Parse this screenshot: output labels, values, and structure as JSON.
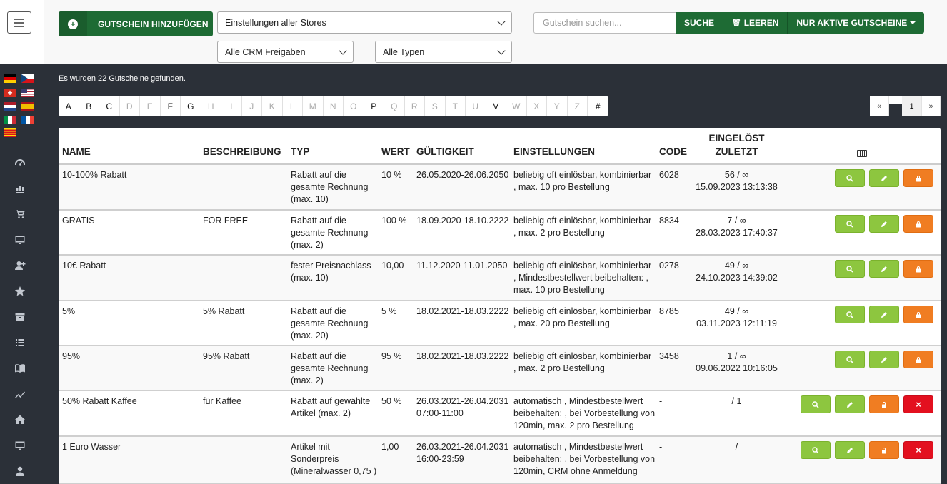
{
  "topbar": {
    "add_button": "GUTSCHEIN HINZUFÜGEN",
    "store_select": "Einstellungen aller Stores",
    "crm_select": "Alle CRM Freigaben",
    "type_select": "Alle Typen",
    "search_placeholder": "Gutschein suchen...",
    "search_button": "SUCHE",
    "clear_button": "LEEREN",
    "active_button": "NUR AKTIVE GUTSCHEINE"
  },
  "status": "Es wurden 22 Gutscheine gefunden.",
  "alphabet": [
    {
      "l": "A",
      "en": true
    },
    {
      "l": "B",
      "en": true
    },
    {
      "l": "C",
      "en": true
    },
    {
      "l": "D",
      "en": false
    },
    {
      "l": "E",
      "en": false
    },
    {
      "l": "F",
      "en": true
    },
    {
      "l": "G",
      "en": true
    },
    {
      "l": "H",
      "en": false
    },
    {
      "l": "I",
      "en": false
    },
    {
      "l": "J",
      "en": false
    },
    {
      "l": "K",
      "en": false
    },
    {
      "l": "L",
      "en": false
    },
    {
      "l": "M",
      "en": false
    },
    {
      "l": "N",
      "en": false
    },
    {
      "l": "O",
      "en": false
    },
    {
      "l": "P",
      "en": true
    },
    {
      "l": "Q",
      "en": false
    },
    {
      "l": "R",
      "en": false
    },
    {
      "l": "S",
      "en": false
    },
    {
      "l": "T",
      "en": false
    },
    {
      "l": "U",
      "en": false
    },
    {
      "l": "V",
      "en": true
    },
    {
      "l": "W",
      "en": false
    },
    {
      "l": "X",
      "en": false
    },
    {
      "l": "Y",
      "en": false
    },
    {
      "l": "Z",
      "en": false
    },
    {
      "l": "#",
      "en": true
    }
  ],
  "pager": {
    "prev": "«",
    "page": "1",
    "next": "»"
  },
  "headers": {
    "name": "NAME",
    "desc": "BESCHREIBUNG",
    "typ": "TYP",
    "wert": "WERT",
    "valid": "GÜLTIGKEIT",
    "settings": "EINSTELLUNGEN",
    "code": "CODE",
    "used_1": "EINGELÖST",
    "used_2": "ZULETZT"
  },
  "rows": [
    {
      "name": "10-100% Rabatt",
      "desc": "",
      "typ": "Rabatt auf die gesamte Rechnung (max. 10)",
      "wert": "10 %",
      "valid": "26.05.2020-26.06.2050",
      "settings": "beliebig oft einlösbar, kombinierbar , max. 10 pro Bestellung",
      "code": "6028",
      "used": "56 / ∞",
      "last": "15.09.2023 13:13:38",
      "delete": false
    },
    {
      "name": "GRATIS",
      "desc": "FOR FREE",
      "typ": "Rabatt auf die gesamte Rechnung (max. 2)",
      "wert": "100 %",
      "valid": "18.09.2020-18.10.2222",
      "settings": "beliebig oft einlösbar, kombinierbar , max. 2 pro Bestellung",
      "code": "8834",
      "used": "7 / ∞",
      "last": "28.03.2023 17:40:37",
      "delete": false
    },
    {
      "name": "10€ Rabatt",
      "desc": "",
      "typ": "fester Preisnachlass (max. 10)",
      "wert": "10,00",
      "valid": "11.12.2020-11.01.2050",
      "settings": "beliebig oft einlösbar, kombinierbar , Mindestbestellwert beibehalten: , max. 10 pro Bestellung",
      "code": "0278",
      "used": "49 / ∞",
      "last": "24.10.2023 14:39:02",
      "delete": false
    },
    {
      "name": "5%",
      "desc": "5% Rabatt",
      "typ": "Rabatt auf die gesamte Rechnung (max. 20)",
      "wert": "5 %",
      "valid": "18.02.2021-18.03.2222",
      "settings": "beliebig oft einlösbar, kombinierbar , max. 20 pro Bestellung",
      "code": "8785",
      "used": "49 / ∞",
      "last": "03.11.2023 12:11:19",
      "delete": false
    },
    {
      "name": "95%",
      "desc": "95% Rabatt",
      "typ": "Rabatt auf die gesamte Rechnung (max. 2)",
      "wert": "95 %",
      "valid": "18.02.2021-18.03.2222",
      "settings": "beliebig oft einlösbar, kombinierbar , max. 2 pro Bestellung",
      "code": "3458",
      "used": "1 / ∞",
      "last": "09.06.2022 10:16:05",
      "delete": false
    },
    {
      "name": "50% Rabatt Kaffee",
      "desc": "für Kaffee",
      "typ": "Rabatt auf gewählte Artikel (max. 2)",
      "wert": "50 %",
      "valid": "26.03.2021-26.04.2031 07:00-11:00",
      "settings": "automatisch , Mindestbestellwert beibehalten: , bei Vorbestellung von 120min, max. 2 pro Bestellung",
      "code": "-",
      "used": "/ 1",
      "last": "",
      "delete": true
    },
    {
      "name": "1 Euro Wasser",
      "desc": "",
      "typ": "Artikel mit Sonderpreis (Mineralwasser 0,75 )",
      "wert": "1,00",
      "valid": "26.03.2021-26.04.2031 16:00-23:59",
      "settings": "automatisch , Mindestbestellwert beibehalten: , bei Vorbestellung von 120min, CRM ohne Anmeldung",
      "code": "-",
      "used": "/",
      "last": "",
      "delete": true
    }
  ],
  "sidebar_icons": [
    "speedometer-icon",
    "bar-chart-icon",
    "cart-icon",
    "monitor-icon",
    "add-user-icon",
    "star-icon",
    "archive-icon",
    "list-icon",
    "book-icon",
    "trend-icon",
    "home-icon",
    "desktop-icon",
    "user-icon"
  ],
  "colors": {
    "green": "#1e6b34",
    "lime": "#8dc63f",
    "orange": "#f07d22",
    "red": "#e3101f",
    "sidebar": "#2b3038"
  }
}
